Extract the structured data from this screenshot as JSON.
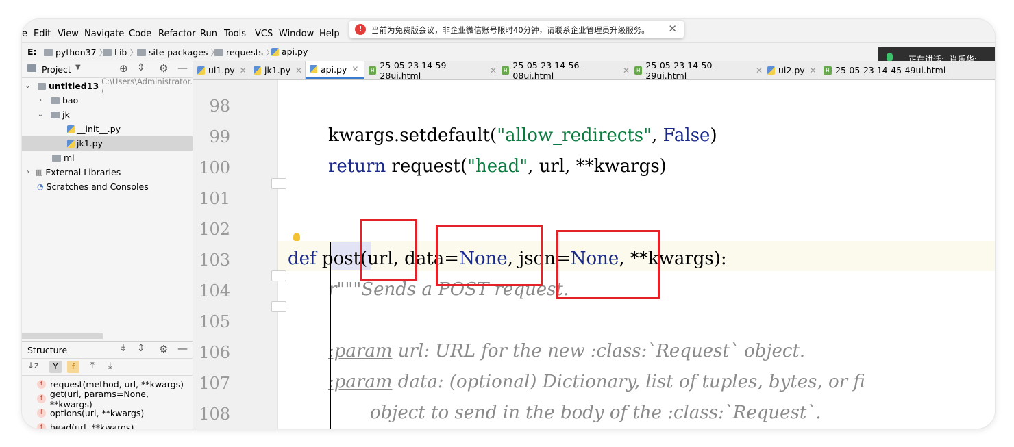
{
  "menu": [
    "e",
    "Edit",
    "View",
    "Navigate",
    "Code",
    "Refactor",
    "Run",
    "Tools",
    "VCS",
    "Window",
    "Help"
  ],
  "toast": {
    "message": "当前为免费版会议，非企业微信账号限时40分钟，请联系企业管理员升级服务。",
    "close": "✕"
  },
  "breadcrumb": [
    "E:",
    "python37",
    "Lib",
    "site-packages",
    "requests",
    "api.py"
  ],
  "speaking": {
    "label": "正在讲话:",
    "name": "肖乐华;"
  },
  "project": {
    "title": "Project",
    "tree": [
      {
        "label": "untitled13",
        "extra": "C:\\Users\\Administrator.("
      },
      {
        "label": "bao"
      },
      {
        "label": "jk"
      },
      {
        "label": "__init__.py"
      },
      {
        "label": "jk1.py"
      },
      {
        "label": "ml"
      },
      {
        "label": "External Libraries"
      },
      {
        "label": "Scratches and Consoles"
      }
    ]
  },
  "structure": {
    "title": "Structure",
    "items": [
      "request(method, url, **kwargs)",
      "get(url, params=None, **kwargs)",
      "options(url, **kwargs)",
      "head(url, **kwargs)"
    ]
  },
  "tabs": [
    "ui1.py",
    "jk1.py",
    "api.py",
    "25-05-23 14-59-28ui.html",
    "25-05-23 14-56-08ui.html",
    "25-05-23 14-50-29ui.html",
    "ui2.py",
    "25-05-23 14-45-49ui.html"
  ],
  "lines": [
    "98",
    "99",
    "100",
    "101",
    "102",
    "103",
    "104",
    "105",
    "106",
    "107",
    "108"
  ],
  "code": {
    "l99_a": "kwargs.setdefault(",
    "l99_str": "\"allow_redirects\"",
    "l99_b": ", ",
    "l99_false": "False",
    "l99_c": ")",
    "l100_kw": "return",
    "l100_a": " request(",
    "l100_str": "\"head\"",
    "l100_b": ", url, **kwargs)",
    "l103_def": "def",
    "l103_post": " post",
    "l103_a": "(url, data=",
    "l103_none1": "None",
    "l103_b": ", json=",
    "l103_none2": "None",
    "l103_c": ", **kwargs):",
    "l104": "r\"\"\"Sends a POST request.",
    "l106_param": ":param",
    "l106_rest": " url: URL for the new :class:`Request` object.",
    "l107_param": ":param",
    "l107_rest": " data: (optional) Dictionary, list of tuples, bytes, or fi",
    "l108": "object to send in the body of the :class:`Request`."
  }
}
